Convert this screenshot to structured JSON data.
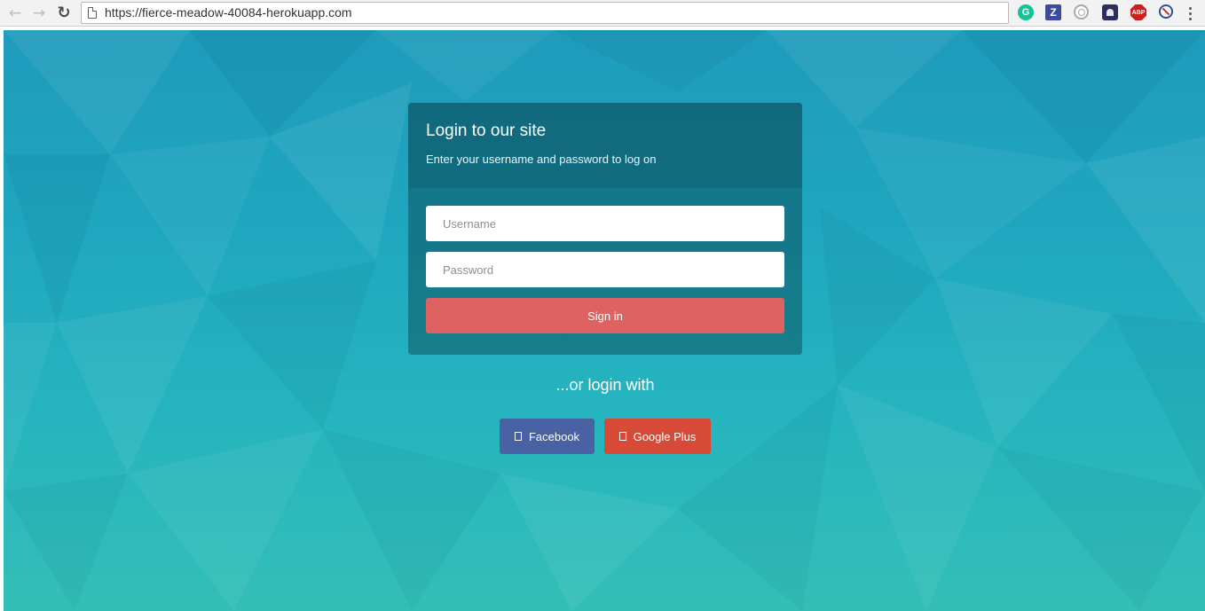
{
  "browser": {
    "url": "https://fierce-meadow-40084-herokuapp.com",
    "back_icon": "←",
    "forward_icon": "→",
    "reload_icon": "↻",
    "extensions": [
      {
        "name": "grammarly-icon",
        "glyph": "G"
      },
      {
        "name": "zotero-icon",
        "glyph": "Z"
      },
      {
        "name": "ring-extension-icon",
        "glyph": ""
      },
      {
        "name": "bug-extension-icon",
        "glyph": ""
      },
      {
        "name": "adblock-plus-icon",
        "glyph": "ABP"
      },
      {
        "name": "block-extension-icon",
        "glyph": ""
      }
    ]
  },
  "login": {
    "title": "Login to our site",
    "subtitle": "Enter your username and password to log on",
    "username_placeholder": "Username",
    "password_placeholder": "Password",
    "username_value": "",
    "password_value": "",
    "signin_label": "Sign in"
  },
  "alt_login": {
    "text": "...or login with",
    "facebook_label": "Facebook",
    "google_label": "Google Plus"
  },
  "colors": {
    "signin": "#de6262",
    "facebook": "#4862a3",
    "google": "#d84a38",
    "background_top": "#1f9bbb",
    "background_bottom": "#33bfb6"
  }
}
